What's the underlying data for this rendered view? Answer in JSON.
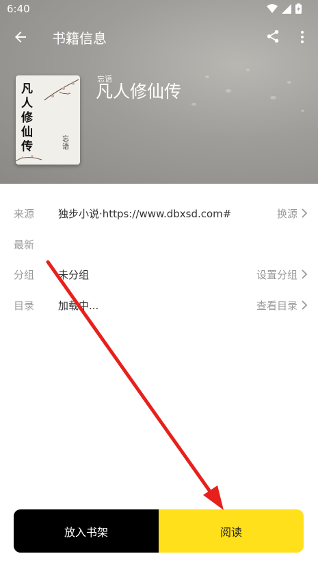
{
  "status_bar": {
    "time": "6:40"
  },
  "app_bar": {
    "title": "书籍信息"
  },
  "book": {
    "cover_title": "凡人修仙传",
    "cover_author": "忘语",
    "name": "凡人修仙传",
    "author": "忘语"
  },
  "info_rows": {
    "source": {
      "label": "来源",
      "value": "独步小说·https://www.dbxsd.com#",
      "action": "换源"
    },
    "latest": {
      "label": "最新",
      "value": ""
    },
    "group": {
      "label": "分组",
      "value": "未分组",
      "action": "设置分组"
    },
    "toc": {
      "label": "目录",
      "value": "加载中...",
      "action": "查看目录"
    }
  },
  "bottom_bar": {
    "add_to_shelf": "放入书架",
    "read": "阅读"
  },
  "colors": {
    "read_button": "#ffe01b",
    "shelf_button": "#000000",
    "annotation_arrow": "#e8201c"
  }
}
